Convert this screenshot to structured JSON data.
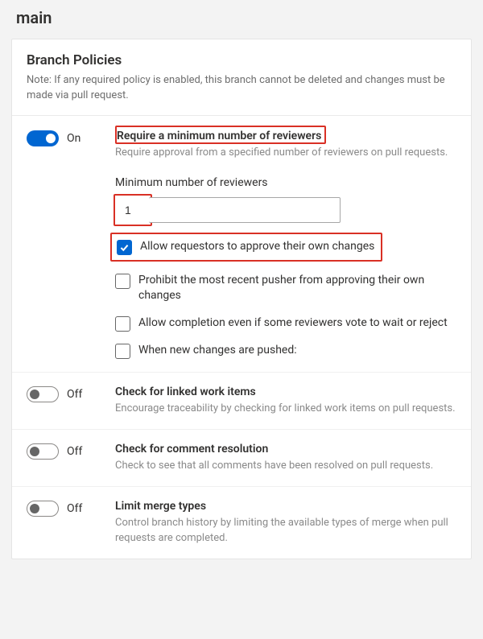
{
  "page": {
    "title": "main"
  },
  "section": {
    "title": "Branch Policies",
    "note": "Note: If any required policy is enabled, this branch cannot be deleted and changes must be made via pull request."
  },
  "toggle_labels": {
    "on": "On",
    "off": "Off"
  },
  "policies": {
    "min_reviewers": {
      "title": "Require a minimum number of reviewers",
      "desc": "Require approval from a specified number of reviewers on pull requests.",
      "enabled": true,
      "min_label": "Minimum number of reviewers",
      "min_value": "1",
      "opts": {
        "allow_self": {
          "label": "Allow requestors to approve their own changes",
          "checked": true
        },
        "prohibit_recent": {
          "label": "Prohibit the most recent pusher from approving their own changes",
          "checked": false
        },
        "allow_completion": {
          "label": "Allow completion even if some reviewers vote to wait or reject",
          "checked": false
        },
        "on_new_changes": {
          "label": "When new changes are pushed:",
          "checked": false
        }
      }
    },
    "linked_items": {
      "title": "Check for linked work items",
      "desc": "Encourage traceability by checking for linked work items on pull requests.",
      "enabled": false
    },
    "comment_resolution": {
      "title": "Check for comment resolution",
      "desc": "Check to see that all comments have been resolved on pull requests.",
      "enabled": false
    },
    "limit_merge": {
      "title": "Limit merge types",
      "desc": "Control branch history by limiting the available types of merge when pull requests are completed.",
      "enabled": false
    }
  }
}
